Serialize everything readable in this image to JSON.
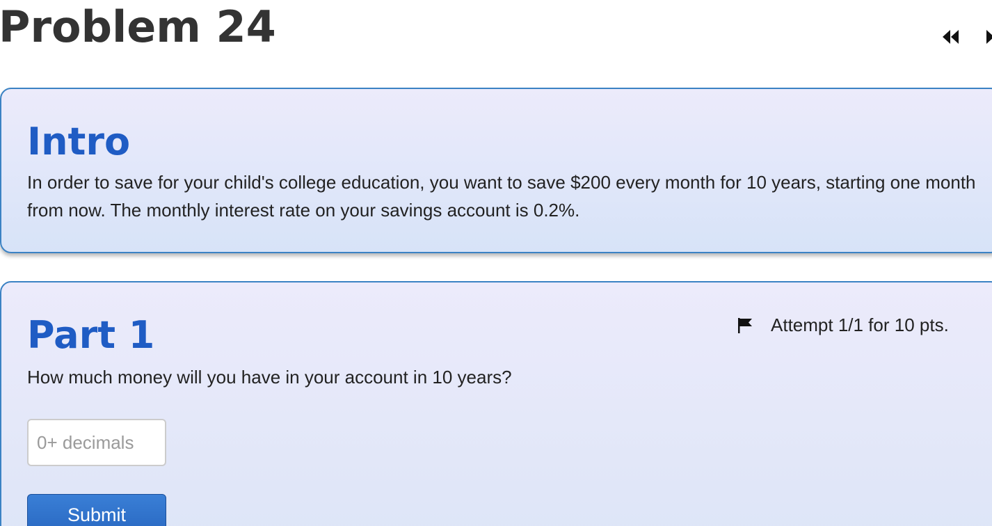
{
  "problem": {
    "title": "Problem 24"
  },
  "nav": {
    "prev_icon": "rewind-icon",
    "next_icon": "fast-forward-icon"
  },
  "intro": {
    "heading": "Intro",
    "text": "In order to save for your child's college education, you want to save $200 every month for 10 years, starting one month from now. The monthly interest rate on your savings account is 0.2%."
  },
  "part1": {
    "heading": "Part 1",
    "attempt_text": "Attempt 1/1 for 10 pts.",
    "question": "How much money will you have in your account in 10 years?",
    "input_placeholder": "0+ decimals",
    "input_value": "",
    "submit_label": "Submit"
  },
  "colors": {
    "heading_blue": "#1f5cc4",
    "card_border": "#3b82c4",
    "button_blue": "#2d6fcb",
    "title_gray": "#333333"
  }
}
